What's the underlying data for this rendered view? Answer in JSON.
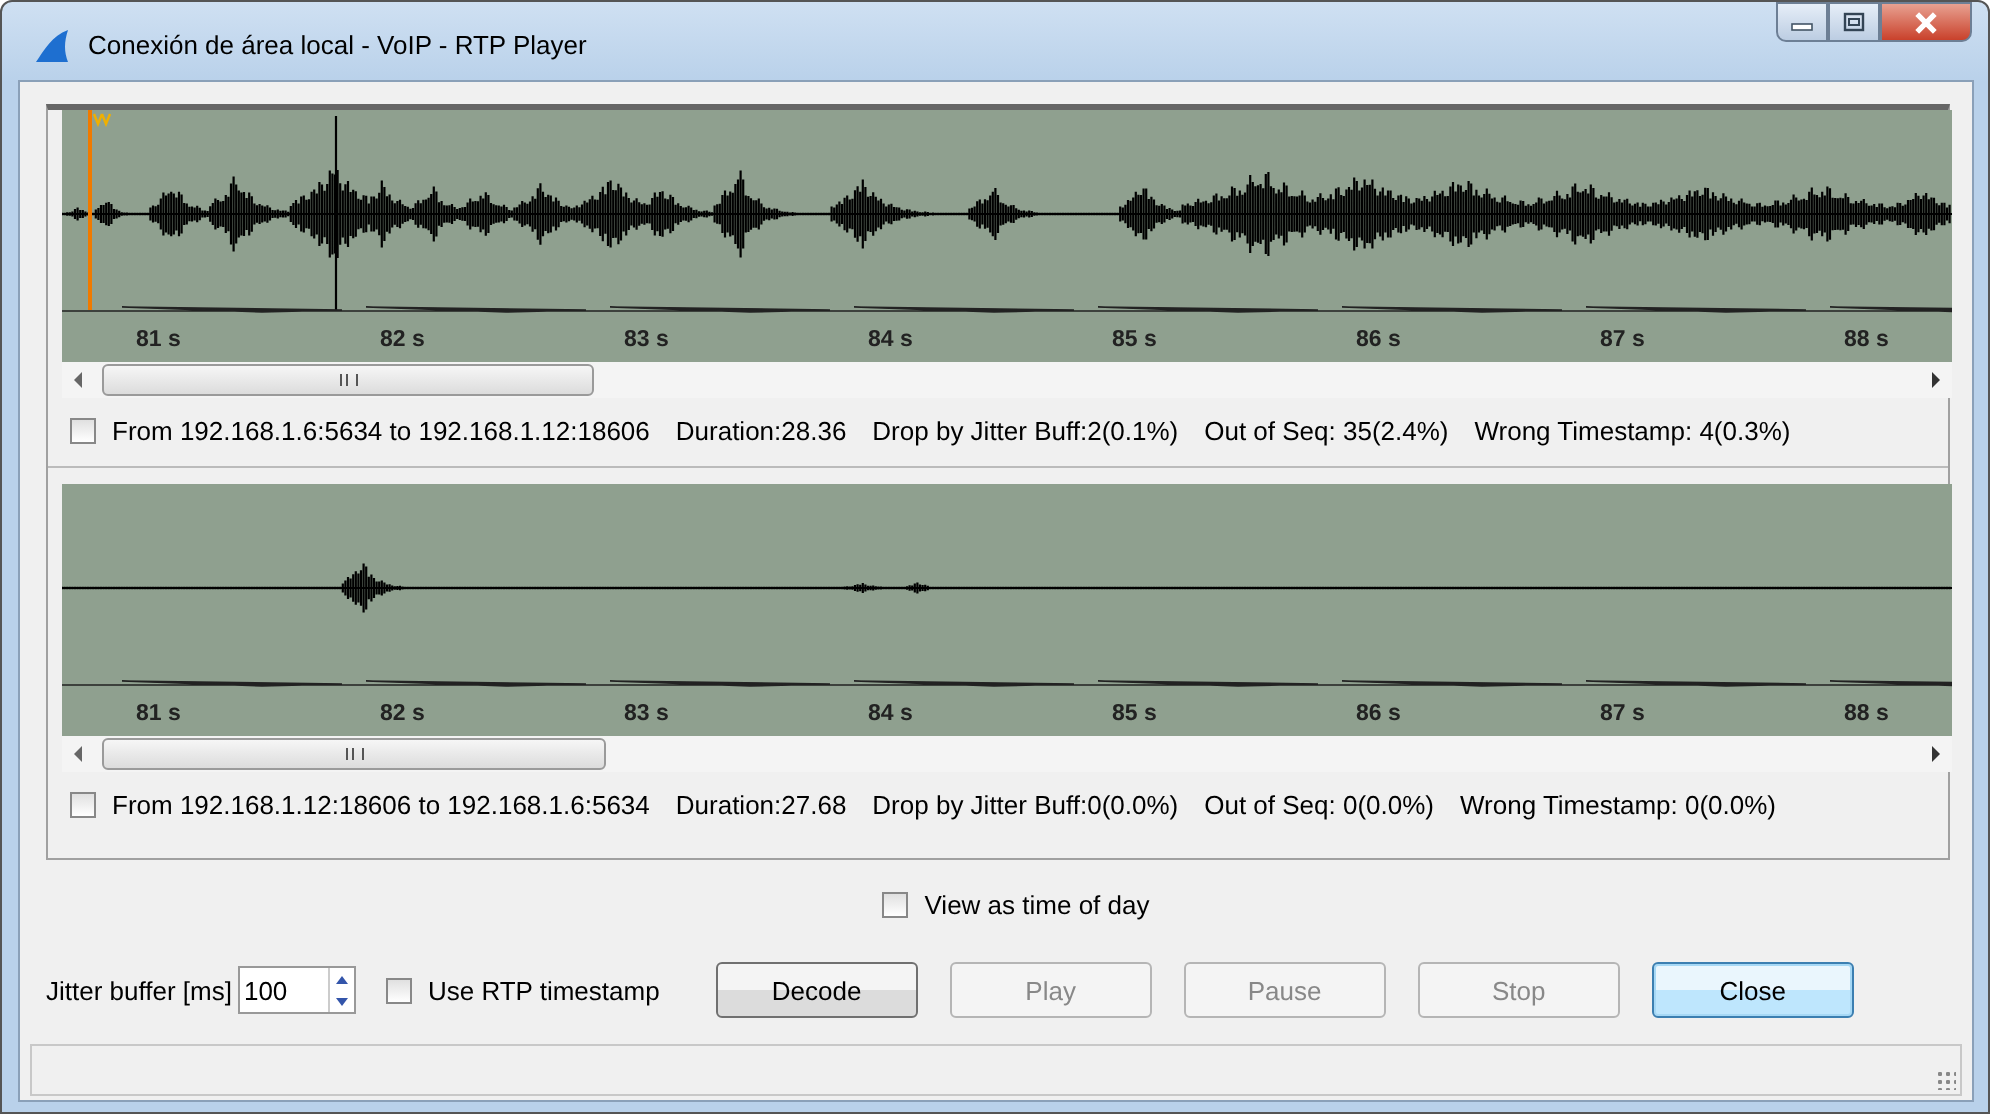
{
  "window": {
    "title": "Conexión de área local - VoIP - RTP Player"
  },
  "streams": [
    {
      "cursor": true,
      "ticks": [
        "81 s",
        "82 s",
        "83 s",
        "84 s",
        "85 s",
        "86 s",
        "87 s",
        "88 s"
      ],
      "checked": false,
      "info": [
        "From 192.168.1.6:5634 to 192.168.1.12:18606",
        "Duration:28.36",
        "Drop by Jitter Buff:2(0.1%)",
        "Out of Seq: 35(2.4%)",
        "Wrong Timestamp: 4(0.3%)"
      ]
    },
    {
      "cursor": false,
      "ticks": [
        "81 s",
        "82 s",
        "83 s",
        "84 s",
        "85 s",
        "86 s",
        "87 s",
        "88 s"
      ],
      "checked": false,
      "info": [
        "From 192.168.1.12:18606 to 192.168.1.6:5634",
        "Duration:27.68",
        "Drop by Jitter Buff:0(0.0%)",
        "Out of Seq: 0(0.0%)",
        "Wrong Timestamp: 0(0.0%)"
      ]
    }
  ],
  "view_time_of_day": {
    "label": "View as time of day",
    "checked": false
  },
  "jitter": {
    "label": "Jitter buffer [ms]",
    "value": "100"
  },
  "use_rtp": {
    "label": "Use RTP timestamp",
    "checked": false
  },
  "buttons": [
    {
      "label": "Decode",
      "disabled": false,
      "default": false
    },
    {
      "label": "Play",
      "disabled": true,
      "default": false
    },
    {
      "label": "Pause",
      "disabled": true,
      "default": false
    },
    {
      "label": "Stop",
      "disabled": true,
      "default": false
    },
    {
      "label": "Close",
      "disabled": false,
      "default": true
    }
  ]
}
